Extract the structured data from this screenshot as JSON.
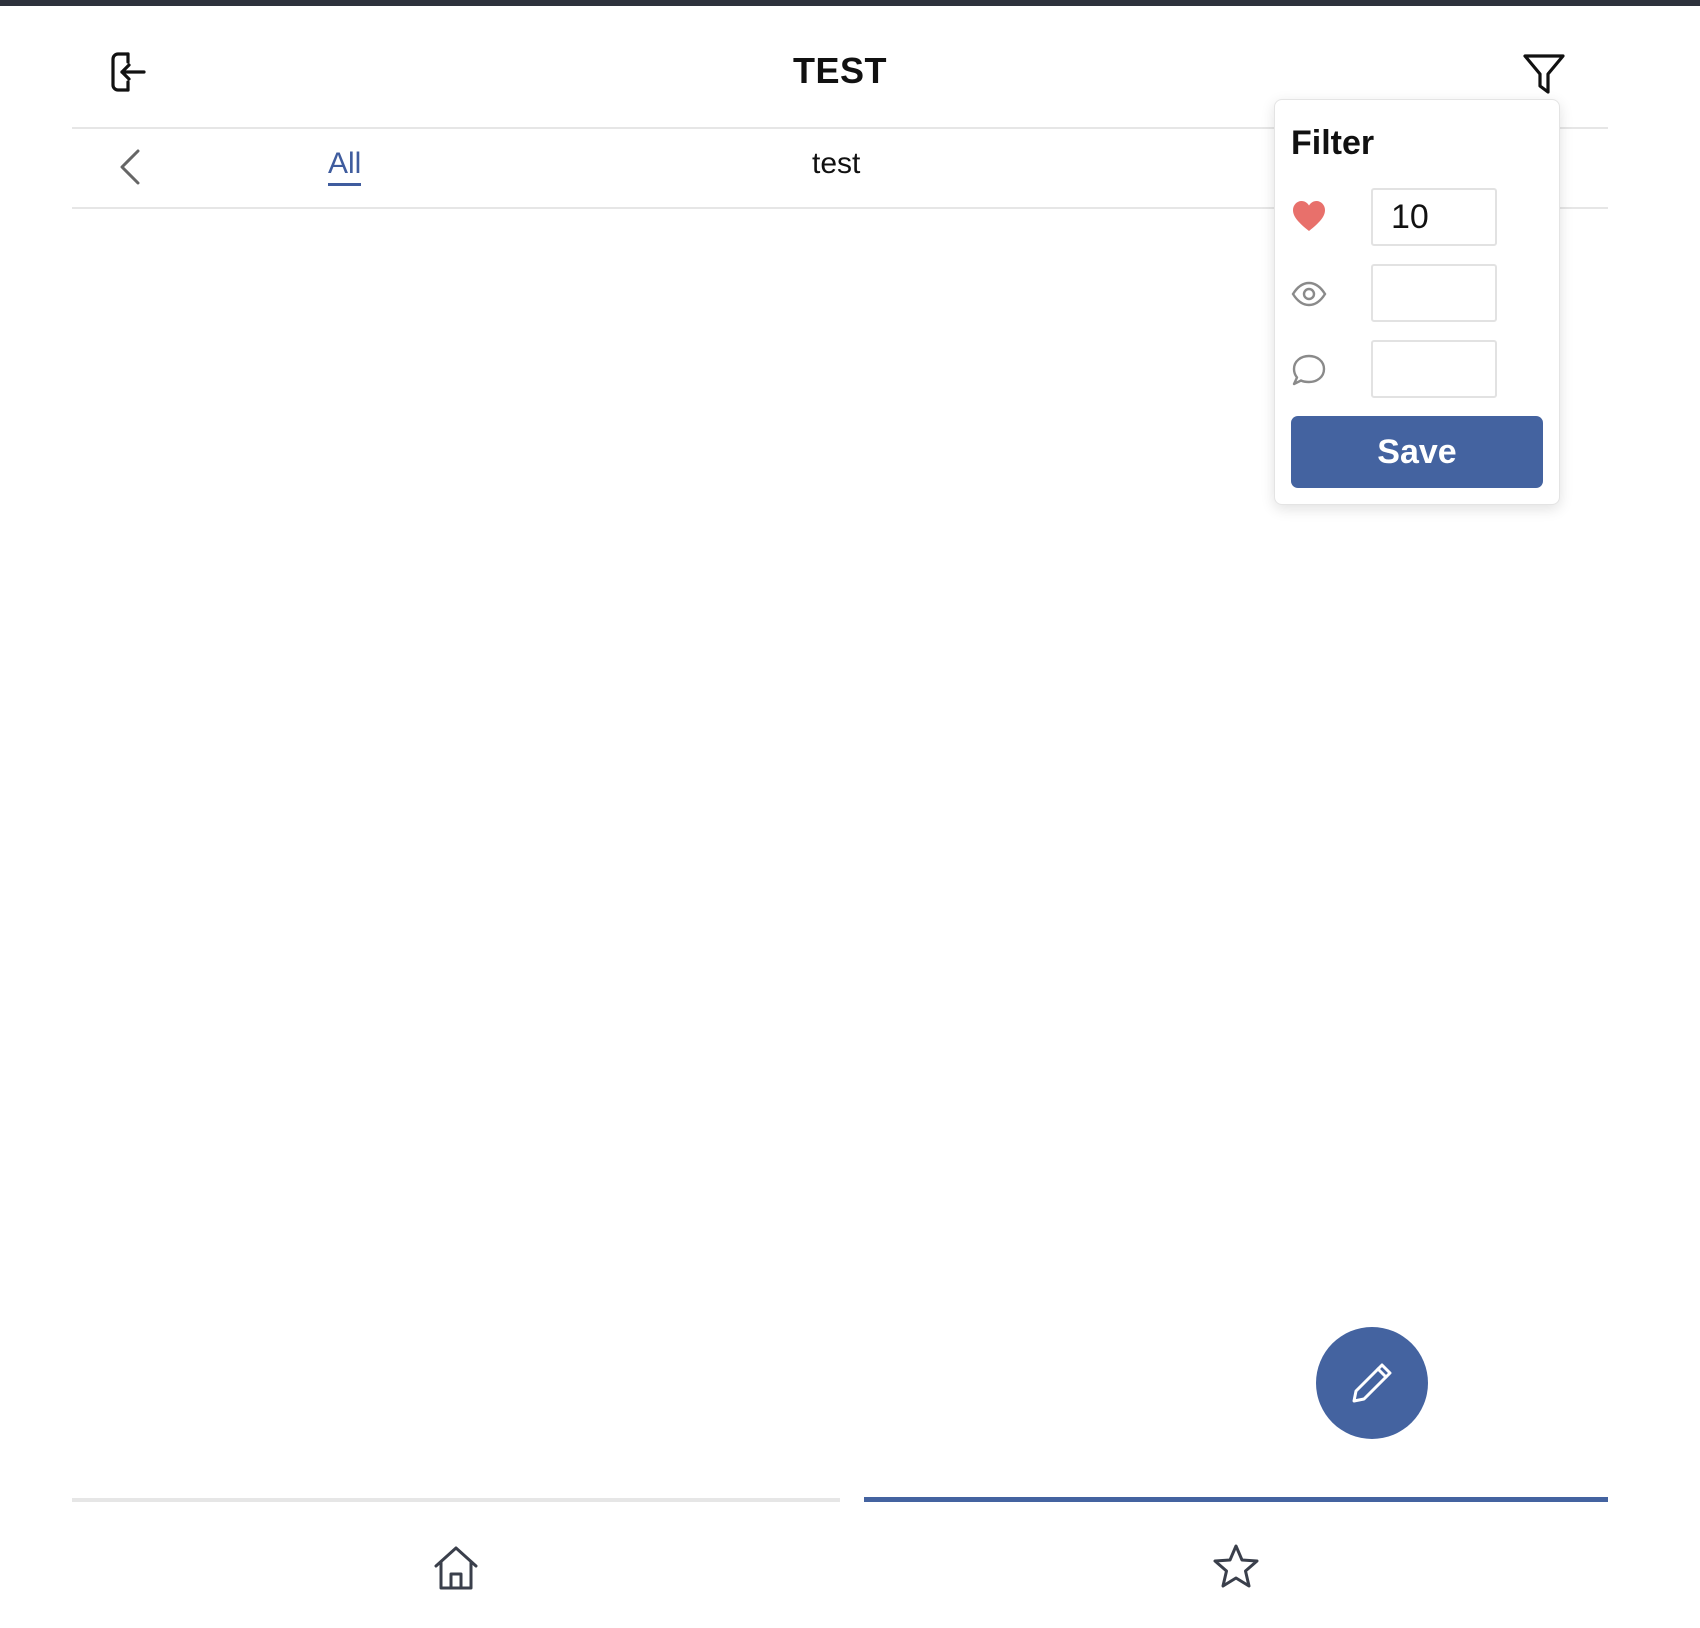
{
  "header": {
    "title": "TEST",
    "logout_icon": "logout-icon",
    "filter_icon": "filter-funnel-icon"
  },
  "tabs": {
    "back_icon": "chevron-left-icon",
    "items": [
      {
        "label": "All",
        "active": true
      },
      {
        "label": "test",
        "active": false
      }
    ]
  },
  "filter_panel": {
    "title": "Filter",
    "rows": [
      {
        "icon": "heart-icon",
        "value": "10"
      },
      {
        "icon": "eye-icon",
        "value": ""
      },
      {
        "icon": "comment-icon",
        "value": ""
      }
    ],
    "save_label": "Save"
  },
  "fab": {
    "icon": "pencil-icon"
  },
  "bottom_nav": {
    "items": [
      {
        "icon": "home-icon",
        "active": false
      },
      {
        "icon": "star-icon",
        "active": true
      }
    ]
  },
  "colors": {
    "accent": "#4463a0",
    "heart": "#e8706b",
    "divider": "#e6e6e6",
    "top_strip": "#2e323c"
  }
}
